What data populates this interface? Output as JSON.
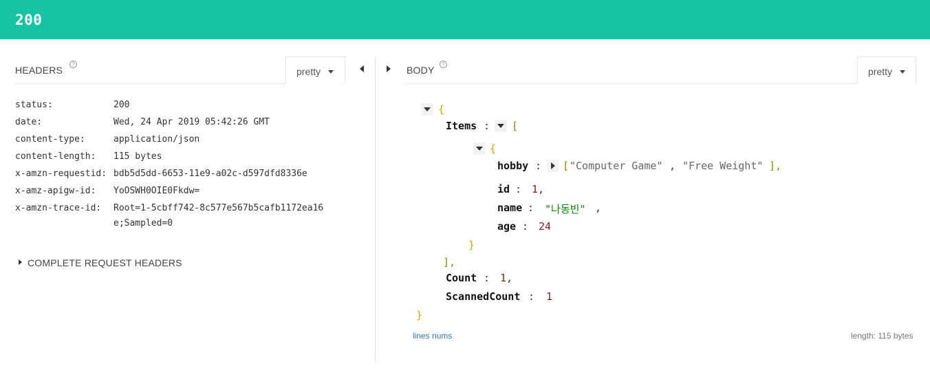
{
  "status": {
    "code": "200"
  },
  "headers_panel": {
    "title": "HEADERS",
    "help": "?",
    "format": "pretty",
    "rows": [
      {
        "key": "status:",
        "value": "200"
      },
      {
        "key": "date:",
        "value": "Wed, 24 Apr 2019 05:42:26 GMT"
      },
      {
        "key": "content-type:",
        "value": "application/json"
      },
      {
        "key": "content-length:",
        "value": "115 bytes"
      },
      {
        "key": "x-amzn-requestid:",
        "value": "bdb5d5dd-6653-11e9-a02c-d597dfd8336e"
      },
      {
        "key": "x-amz-apigw-id:",
        "value": "YoOSWH0OIE0Fkdw="
      },
      {
        "key": "x-amzn-trace-id:",
        "value": "Root=1-5cbff742-8c577e567b5cafb1172ea16",
        "value2": "e;Sampled=0"
      }
    ],
    "complete_request_headers": "COMPLETE REQUEST HEADERS"
  },
  "body_panel": {
    "title": "BODY",
    "help": "?",
    "format": "pretty",
    "json": {
      "open_brace": "{",
      "close_brace": "}",
      "items_key": "Items",
      "items_open": "[",
      "items_close": "],",
      "item_open": "{",
      "item_close": "}",
      "hobby_key": "hobby",
      "hobby_open": "[",
      "hobby_values": [
        "\"Computer Game\"",
        "\"Free Weight\""
      ],
      "hobby_close": "],",
      "id_key": "id",
      "id_value": "1",
      "name_key": "name",
      "name_value": "\"나동빈\"",
      "age_key": "age",
      "age_value": "24",
      "count_key": "Count",
      "count_value": "1",
      "scanned_key": "ScannedCount",
      "scanned_value": "1",
      "colon": ":",
      "comma": ","
    },
    "lines_nums": "lines nums",
    "length": "length: 115 bytes"
  }
}
